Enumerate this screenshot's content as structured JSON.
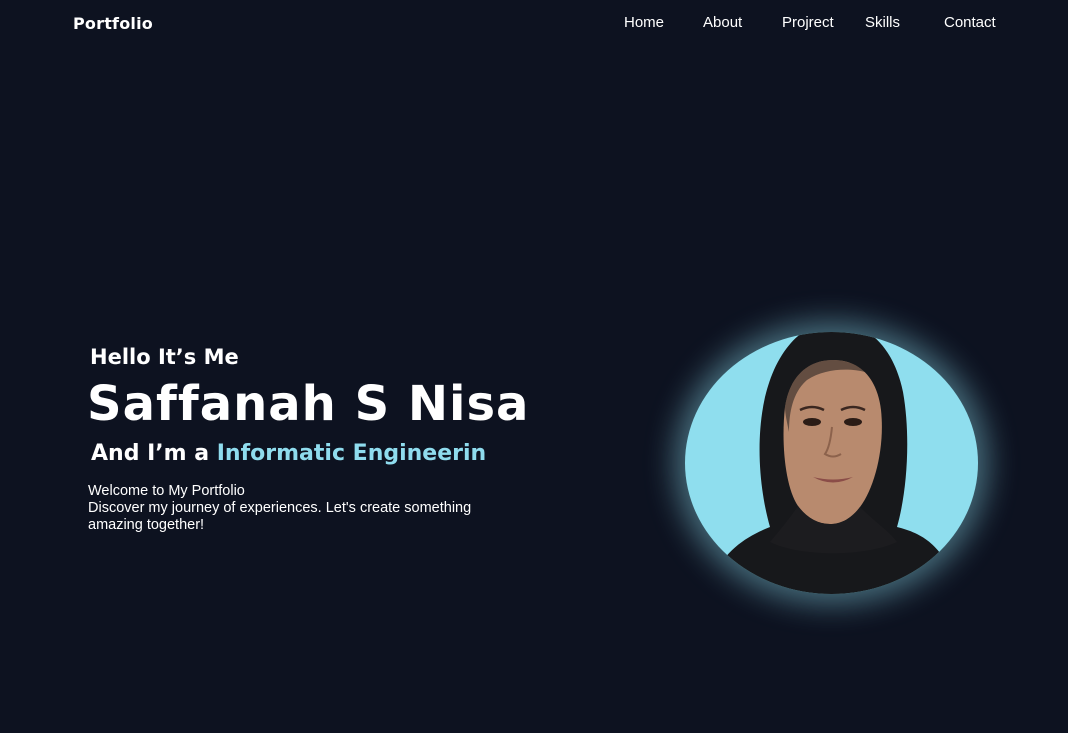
{
  "header": {
    "logo": "Portfolio",
    "nav": {
      "home": "Home",
      "about": "About",
      "project": "Projrect",
      "skills": "Skills",
      "contact": "Contact"
    }
  },
  "hero": {
    "greeting": "Hello It’s Me",
    "name": "Saffanah S Nisa",
    "role_prefix": "And I’m a",
    "role_accent": "Informatic Engineerin",
    "intro_line1": "Welcome to My Portfolio",
    "intro_line2": "Discover my journey of experiences. Let's create something",
    "intro_line3": "amazing together!"
  },
  "colors": {
    "background": "#0d1220",
    "accent": "#8fdcee",
    "text": "#ffffff"
  }
}
